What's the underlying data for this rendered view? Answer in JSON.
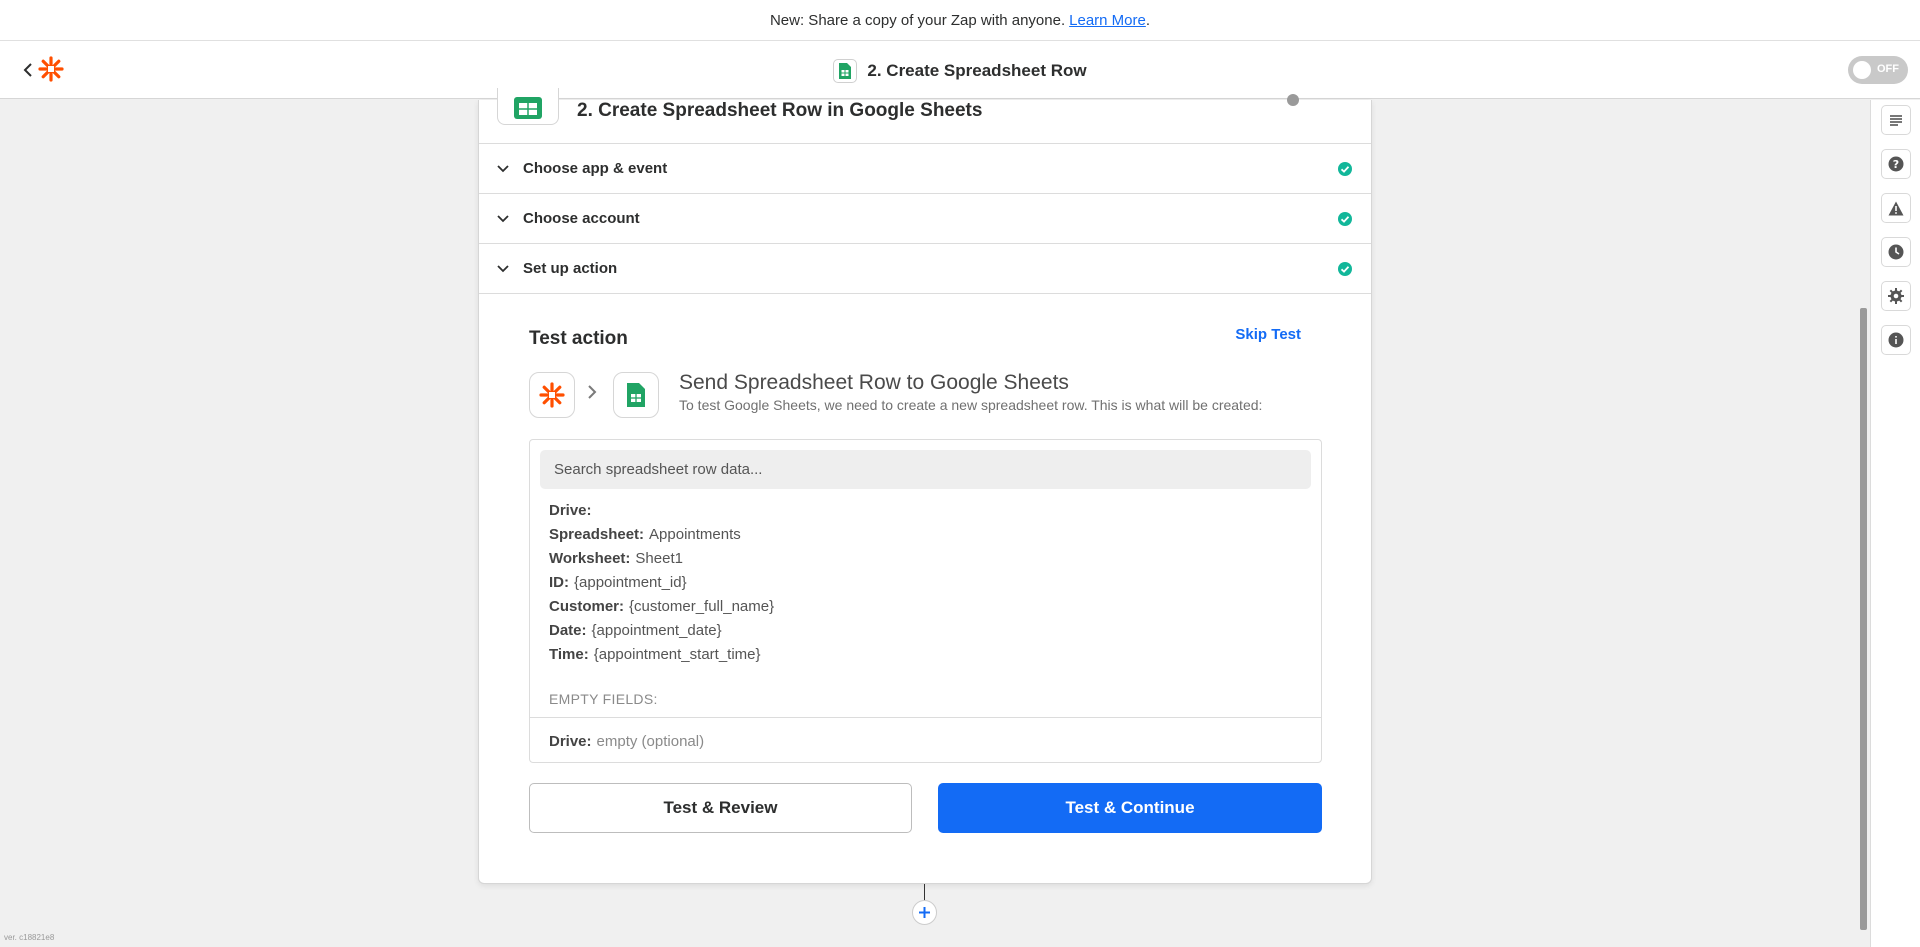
{
  "banner": {
    "text": "New: Share a copy of your Zap with anyone.",
    "link": "Learn More",
    "suffix": "."
  },
  "topbar": {
    "zap_title": "2. Create Spreadsheet Row",
    "toggle_label": "OFF"
  },
  "step": {
    "title": "2. Create Spreadsheet Row in Google Sheets"
  },
  "sections": [
    {
      "label": "Choose app & event"
    },
    {
      "label": "Choose account"
    },
    {
      "label": "Set up action"
    }
  ],
  "test": {
    "title": "Test action",
    "skip_label": "Skip Test",
    "send_title": "Send Spreadsheet Row to Google Sheets",
    "send_sub": "To test Google Sheets, we need to create a new spreadsheet row. This is what will be created:",
    "search_placeholder": "Search spreadsheet row data...",
    "rows": [
      {
        "key": "Drive:",
        "value": ""
      },
      {
        "key": "Spreadsheet:",
        "value": "Appointments"
      },
      {
        "key": "Worksheet:",
        "value": "Sheet1"
      },
      {
        "key": "ID:",
        "value": "{appointment_id}"
      },
      {
        "key": "Customer:",
        "value": "{customer_full_name}"
      },
      {
        "key": "Date:",
        "value": "{appointment_date}"
      },
      {
        "key": "Time:",
        "value": "{appointment_start_time}"
      }
    ],
    "empty_header": "EMPTY FIELDS:",
    "empty_row": {
      "key": "Drive:",
      "value": "empty (optional)"
    },
    "review_label": "Test & Review",
    "continue_label": "Test & Continue"
  },
  "version": "ver. c18821e8",
  "colors": {
    "accent": "#136bf5",
    "success": "#12b79a",
    "zapier_orange": "#ff4f00",
    "sheets_green": "#20a464"
  },
  "icons": {
    "back": "chevron-left-icon",
    "logo": "zapier-logo",
    "rail": [
      "notes-icon",
      "help-icon",
      "warning-icon",
      "history-icon",
      "settings-icon",
      "info-icon"
    ]
  }
}
